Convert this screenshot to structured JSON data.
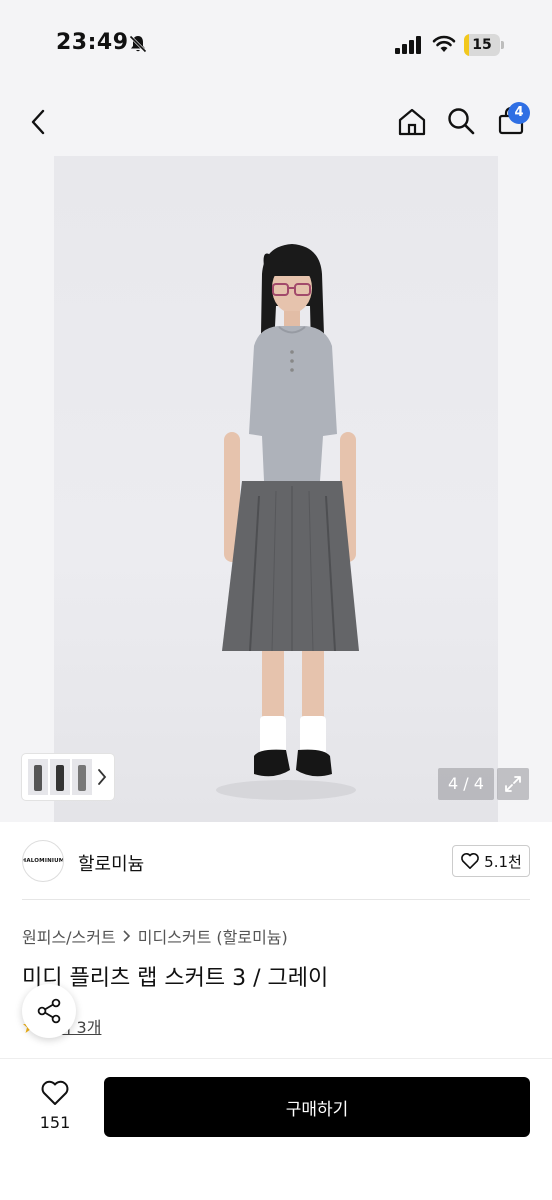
{
  "status_bar": {
    "time": "23:49",
    "battery_level": "15",
    "battery_fraction": 0.15,
    "icons": [
      "bell-off-icon",
      "cellular-signal-icon",
      "wifi-icon",
      "battery-icon"
    ]
  },
  "nav": {
    "icons": [
      "back-icon",
      "home-icon",
      "search-icon",
      "shopping-bag-icon"
    ],
    "cart_count": "4"
  },
  "gallery": {
    "counter": "4 / 4",
    "icons": [
      "chevron-right-icon",
      "expand-icon"
    ]
  },
  "brand": {
    "logo_text": "HALOMINIUM",
    "name": "할로미늄",
    "likes": "5.1천",
    "icons": [
      "heart-outline-icon"
    ]
  },
  "breadcrumb": {
    "items": [
      "원피스/스커트",
      "미디스커트 (할로미늄)"
    ]
  },
  "product": {
    "title": "미디 플리츠 랩 스커트 3 / 그레이",
    "reviews": "후기 3개"
  },
  "bottom_bar": {
    "wish_count": "151",
    "buy_label": "구매하기"
  },
  "colors": {
    "accent_badge": "#2f6fe4",
    "battery": "#f2c81d",
    "buy_button": "#000000",
    "background": "#f4f4f6"
  }
}
